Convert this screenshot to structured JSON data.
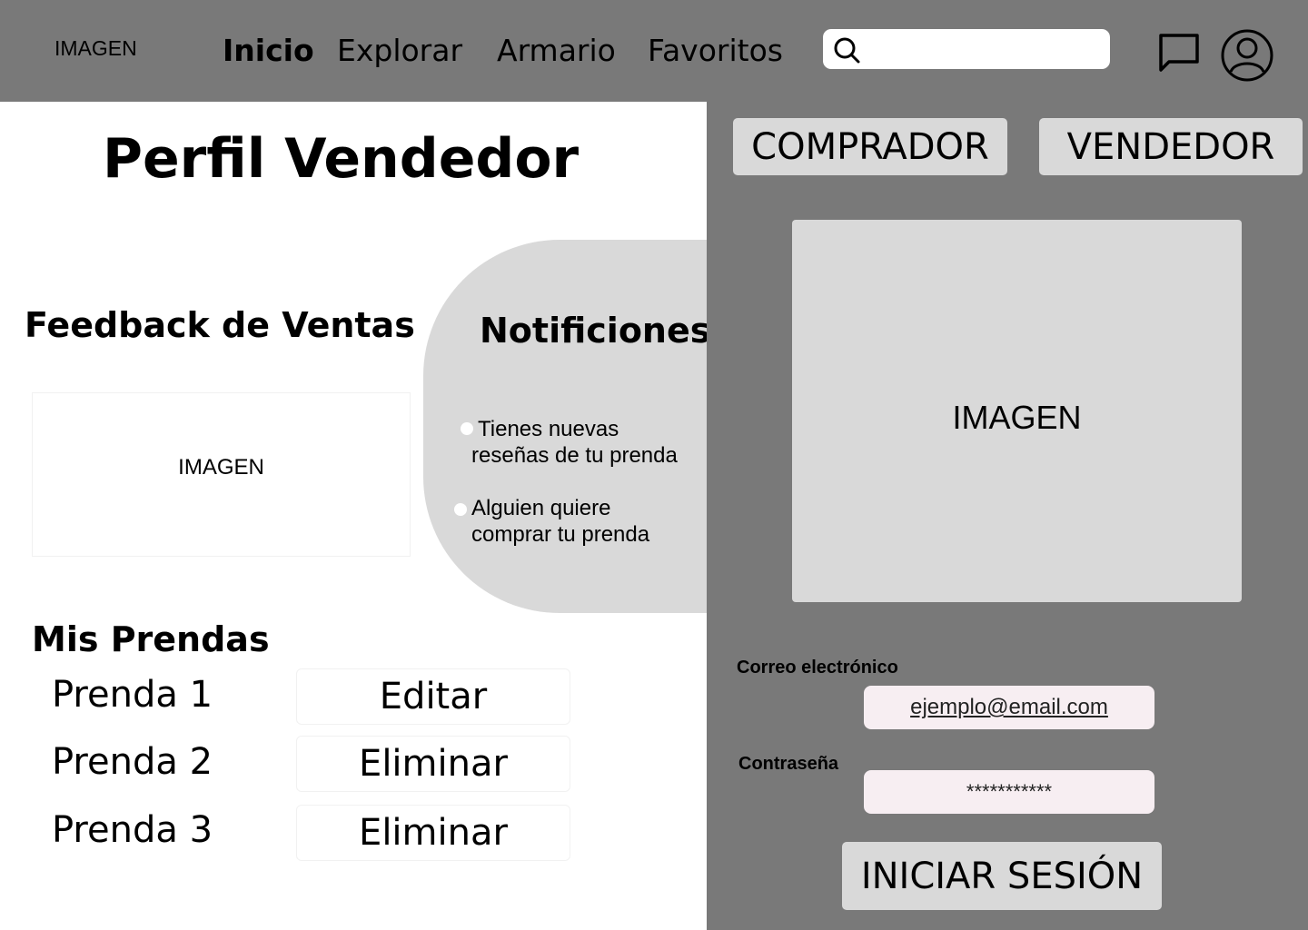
{
  "header": {
    "logo": "IMAGEN",
    "nav": [
      {
        "label": "Inicio",
        "active": true
      },
      {
        "label": "Explorar",
        "active": false
      },
      {
        "label": "Armario",
        "active": false
      },
      {
        "label": "Favoritos",
        "active": false
      }
    ],
    "search": {
      "value": "",
      "placeholder": ""
    },
    "icons": {
      "search": "search-icon",
      "chat": "chat-icon",
      "user": "user-icon"
    }
  },
  "profile": {
    "title": "Perfil Vendedor",
    "feedback": {
      "title": "Feedback de Ventas",
      "image_label": "IMAGEN"
    },
    "notifications": {
      "title": "Notificiones",
      "items": [
        {
          "line1": "Tienes nuevas",
          "line2": "reseñas de tu prenda"
        },
        {
          "line1": "Alguien quiere",
          "line2": "comprar tu prenda"
        }
      ]
    },
    "items": {
      "title": "Mis Prendas",
      "rows": [
        {
          "name": "Prenda 1",
          "action": "Editar"
        },
        {
          "name": "Prenda 2",
          "action": "Eliminar"
        },
        {
          "name": "Prenda 3",
          "action": "Eliminar"
        }
      ]
    }
  },
  "login": {
    "roles": [
      "COMPRADOR",
      "VENDEDOR"
    ],
    "image_label": "IMAGEN",
    "email": {
      "label": "Correo electrónico",
      "value": "ejemplo@email.com"
    },
    "password": {
      "label": "Contraseña",
      "value": "***********"
    },
    "submit": "INICIAR SESIÓN"
  },
  "colors": {
    "header_bg": "#797979",
    "panel_bg": "#797979",
    "card_bg": "#d9d9d9",
    "field_bg": "#f7eef2",
    "page_bg": "#ffffff"
  }
}
